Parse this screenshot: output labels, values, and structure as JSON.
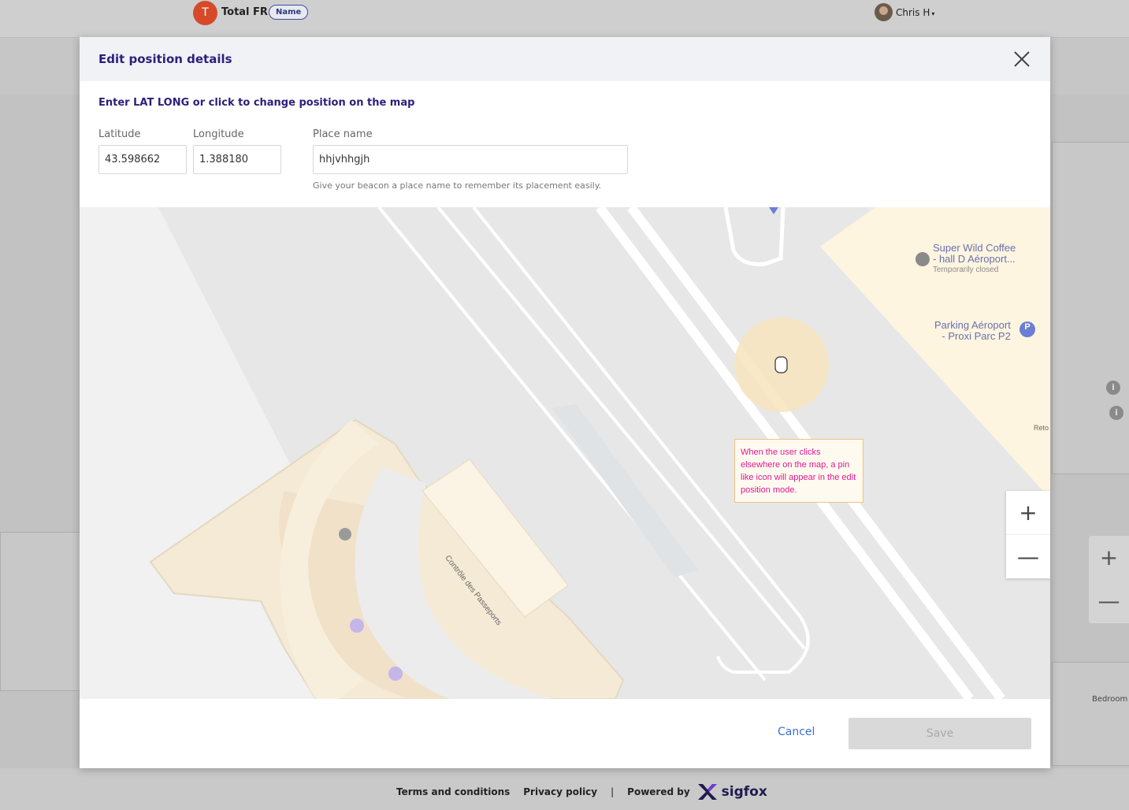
{
  "topbar": {
    "org_initial": "T",
    "org_name": "Total FR",
    "org_badge": "Name",
    "user_name": "Chris H"
  },
  "modal": {
    "title": "Edit position details",
    "instruction": "Enter LAT LONG or click to change position on the map",
    "latitude_label": "Latitude",
    "latitude_value": "43.598662",
    "longitude_label": "Longitude",
    "longitude_value": "1.388180",
    "place_label": "Place name",
    "place_value": "hhjvhhgjh",
    "place_helper": "Give your beacon a place name to remember its placement easily.",
    "cancel_label": "Cancel",
    "save_label": "Save"
  },
  "map": {
    "poi_coffee_line1": "Super Wild Coffee",
    "poi_coffee_line2": "- hall D Aéroport...",
    "poi_coffee_status": "Temporarily closed",
    "poi_parking_line1": "Parking Aéroport",
    "poi_parking_line2": "- Proxi Parc P2",
    "poi_parking_icon": "P",
    "building_label": "Contrôle des Passeports",
    "edge_label": "Reto",
    "annotation": "When the user clicks elsewhere on the map, a pin like icon will appear in the edit position mode.",
    "zoom_in": "+",
    "zoom_out": "—"
  },
  "background": {
    "bedroom_label": "Bedroom",
    "info_icon": "i"
  },
  "footer": {
    "terms": "Terms and conditions",
    "privacy": "Privacy policy",
    "separator": "|",
    "powered_by": "Powered by",
    "brand": "sigfox"
  },
  "colors": {
    "title": "#2b1f7a",
    "link": "#3b6fd6",
    "annotation_text": "#e0198f",
    "org_avatar": "#d64a2a"
  }
}
